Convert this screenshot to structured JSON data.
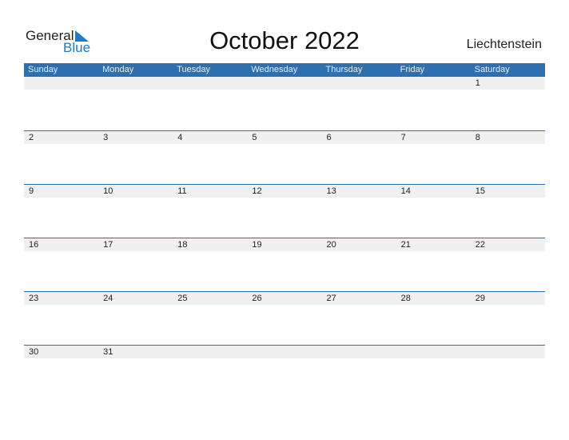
{
  "logo": {
    "word1": "General",
    "word2": "Blue"
  },
  "title": "October 2022",
  "country": "Liechtenstein",
  "colors": {
    "accent": "#2e6fb0",
    "strip": "#f0f0f0"
  },
  "days": [
    "Sunday",
    "Monday",
    "Tuesday",
    "Wednesday",
    "Thursday",
    "Friday",
    "Saturday"
  ],
  "weeks": [
    [
      "",
      "",
      "",
      "",
      "",
      "",
      "1"
    ],
    [
      "2",
      "3",
      "4",
      "5",
      "6",
      "7",
      "8"
    ],
    [
      "9",
      "10",
      "11",
      "12",
      "13",
      "14",
      "15"
    ],
    [
      "16",
      "17",
      "18",
      "19",
      "20",
      "21",
      "22"
    ],
    [
      "23",
      "24",
      "25",
      "26",
      "27",
      "28",
      "29"
    ],
    [
      "30",
      "31",
      "",
      "",
      "",
      "",
      ""
    ]
  ]
}
